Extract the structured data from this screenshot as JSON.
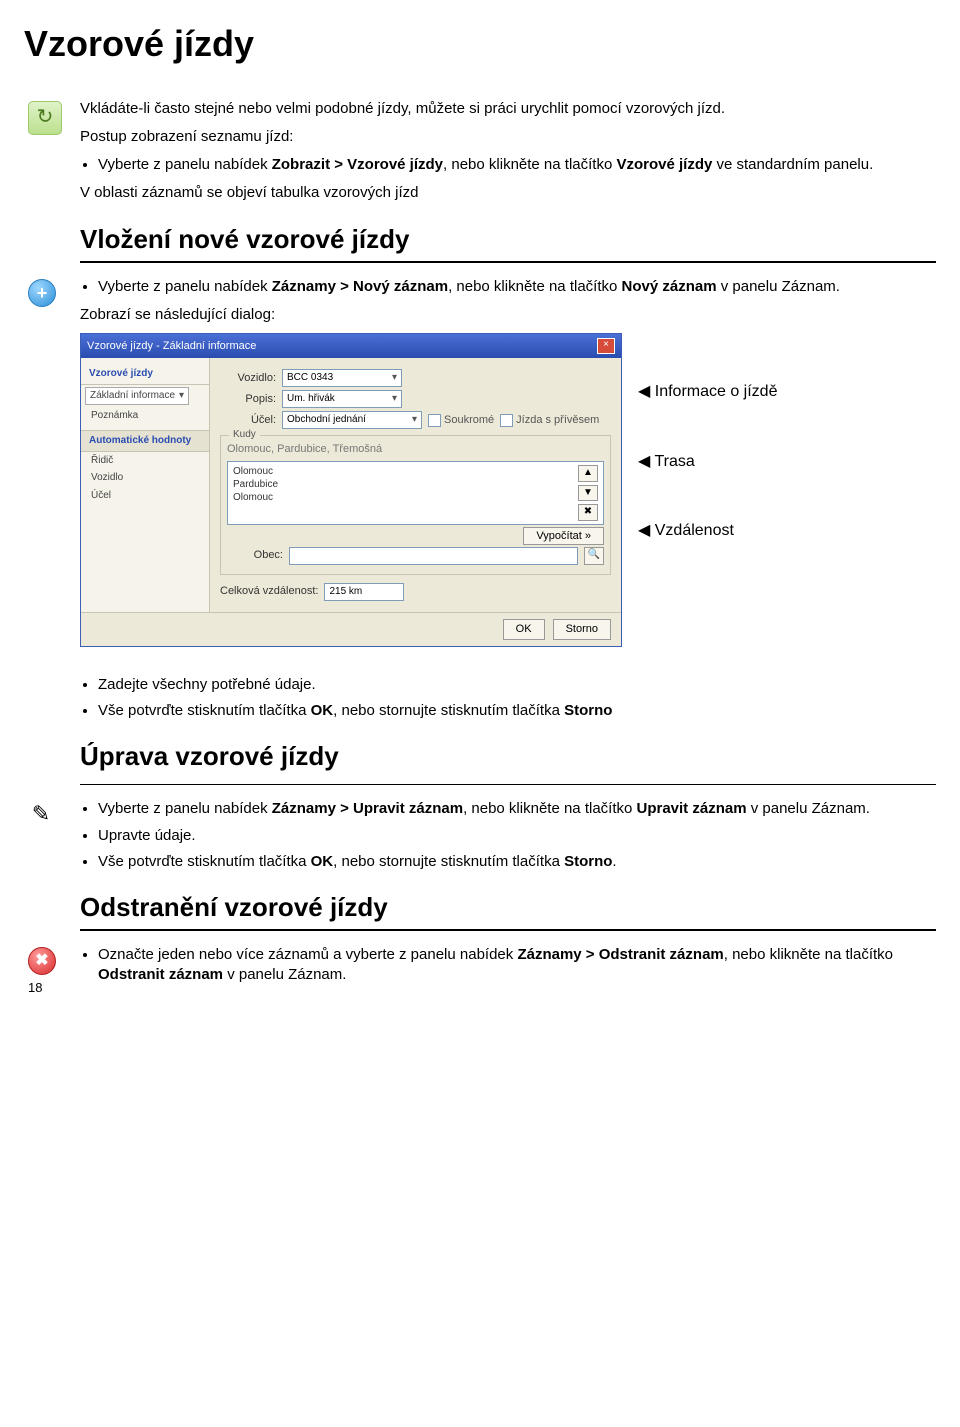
{
  "page_title": "Vzorové jízdy",
  "intro": "Vkládáte-li často stejné nebo velmi podobné jízdy, můžete si práci urychlit pomocí vzorových jízd.",
  "list_heading": "Postup zobrazení seznamu jízd:",
  "list_item1_pre": "Vyberte z panelu nabídek ",
  "list_item1_bold": "Zobrazit > Vzorové jízdy",
  "list_item1_mid": ", nebo klikněte na tlačítko ",
  "list_item1_bold2": "Vzorové jízdy",
  "list_item1_post": " ve standardním panelu.",
  "after_list": "V oblasti záznamů se objeví tabulka vzorových jízd",
  "insert_heading": "Vložení nové vzorové jízdy",
  "insert_item1_pre": "Vyberte z panelu nabídek ",
  "insert_item1_bold": "Záznamy > Nový záznam",
  "insert_item1_mid": ", nebo klikněte na tlačítko ",
  "insert_item1_bold2": "Nový záznam",
  "insert_item1_post": " v panelu Záznam.",
  "insert_after": "Zobrazí se následující dialog:",
  "dialog": {
    "title": "Vzorové jízdy - Základní informace",
    "side_head": "Vzorové jízdy",
    "side_item1": "Základní informace",
    "side_item2": "Poznámka",
    "side_sub_head": "Automatické hodnoty",
    "side_sub1": "Řidič",
    "side_sub2": "Vozidlo",
    "side_sub3": "Účel",
    "lbl_vozidlo": "Vozidlo:",
    "val_vozidlo": "BCC 0343",
    "lbl_popis": "Popis:",
    "val_popis": "Um. hřivák",
    "lbl_ucel": "Účel:",
    "val_ucel": "Obchodní jednání",
    "chk_soukrome": "Soukromé",
    "chk_privesem": "Jízda s přívěsem",
    "group_route": "Kudy",
    "route_hint": "Olomouc, Pardubice, Třemošná",
    "route1": "Olomouc",
    "route2": "Pardubice",
    "route3": "Olomouc",
    "btn_calc": "Vypočítat »",
    "lbl_obec": "Obec:",
    "lbl_dist": "Celková vzdálenost:",
    "val_dist": "215 km",
    "btn_ok": "OK",
    "btn_cancel": "Storno"
  },
  "callout1": "Informace o jízdě",
  "callout2": "Trasa",
  "callout3": "Vzdálenost",
  "enter_item1": "Zadejte všechny potřebné údaje.",
  "confirm_pre": "Vše potvrďte stisknutím tlačítka ",
  "confirm_ok": "OK",
  "confirm_mid": ", nebo stornujte stisknutím tlačítka ",
  "confirm_storno": "Storno",
  "edit_heading": "Úprava vzorové jízdy",
  "edit_item1_pre": "Vyberte z panelu nabídek ",
  "edit_item1_bold": "Záznamy > Upravit záznam",
  "edit_item1_mid": ", nebo klikněte na tlačítko ",
  "edit_item1_bold2": "Upravit záznam",
  "edit_item1_post": " v panelu Záznam.",
  "edit_item2": "Upravte údaje.",
  "edit_confirm_post": ".",
  "delete_heading": "Odstranění vzorové jízdy",
  "delete_item_pre": "Označte jeden nebo více záznamů a vyberte z panelu nabídek ",
  "delete_item_bold": "Záznamy > Odstranit záznam",
  "delete_item_mid": ", nebo klikněte na tlačítko ",
  "delete_item_bold2": "Odstranit záznam",
  "delete_item_post": " v panelu Záznam.",
  "page_number": "18"
}
